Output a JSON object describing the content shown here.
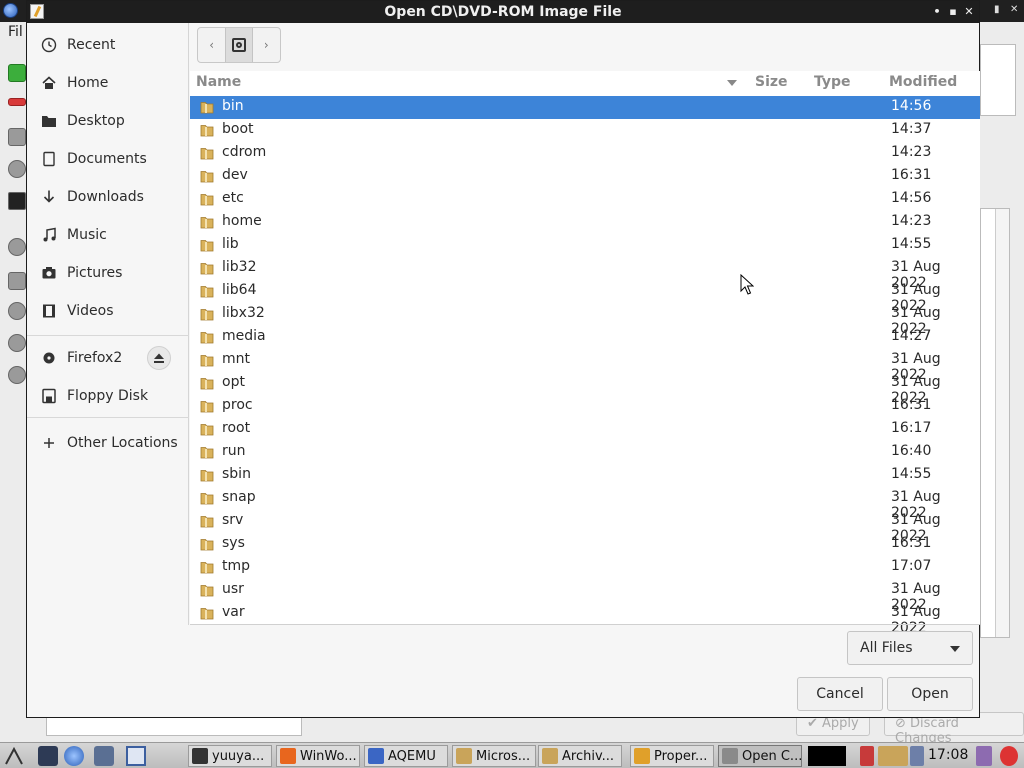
{
  "window": {
    "title": "Open CD\\DVD-ROM Image File",
    "controls": [
      "•",
      "▪",
      "✕"
    ]
  },
  "background_app": {
    "menu_label": "Fil",
    "buttons": {
      "apply": "Apply",
      "discard": "Discard Changes"
    }
  },
  "sidebar": {
    "places": [
      {
        "label": "Recent",
        "icon": "clock-icon"
      },
      {
        "label": "Home",
        "icon": "home-icon"
      },
      {
        "label": "Desktop",
        "icon": "folder-icon"
      },
      {
        "label": "Documents",
        "icon": "document-icon"
      },
      {
        "label": "Downloads",
        "icon": "download-arrow-icon"
      },
      {
        "label": "Music",
        "icon": "music-note-icon"
      },
      {
        "label": "Pictures",
        "icon": "camera-icon"
      },
      {
        "label": "Videos",
        "icon": "film-icon"
      }
    ],
    "devices": [
      {
        "label": "Firefox2",
        "icon": "optical-disc-icon",
        "eject": true
      },
      {
        "label": "Floppy Disk",
        "icon": "floppy-disk-icon"
      }
    ],
    "other": {
      "label": "Other Locations",
      "icon": "plus-icon"
    }
  },
  "pathbar": {
    "back": "‹",
    "forward": "›",
    "current_icon": "disk-drive-icon"
  },
  "filelist": {
    "columns": {
      "name": "Name",
      "size": "Size",
      "type": "Type",
      "modified": "Modified"
    },
    "sort_column": "Name",
    "rows": [
      {
        "name": "bin",
        "modified": "14:56",
        "selected": true
      },
      {
        "name": "boot",
        "modified": "14:37"
      },
      {
        "name": "cdrom",
        "modified": "14:23"
      },
      {
        "name": "dev",
        "modified": "16:31"
      },
      {
        "name": "etc",
        "modified": "14:56"
      },
      {
        "name": "home",
        "modified": "14:23"
      },
      {
        "name": "lib",
        "modified": "14:55"
      },
      {
        "name": "lib32",
        "modified": "31 Aug 2022"
      },
      {
        "name": "lib64",
        "modified": "31 Aug 2022"
      },
      {
        "name": "libx32",
        "modified": "31 Aug 2022"
      },
      {
        "name": "media",
        "modified": "14:27"
      },
      {
        "name": "mnt",
        "modified": "31 Aug 2022"
      },
      {
        "name": "opt",
        "modified": "31 Aug 2022"
      },
      {
        "name": "proc",
        "modified": "16:31"
      },
      {
        "name": "root",
        "modified": "16:17"
      },
      {
        "name": "run",
        "modified": "16:40"
      },
      {
        "name": "sbin",
        "modified": "14:55"
      },
      {
        "name": "snap",
        "modified": "31 Aug 2022"
      },
      {
        "name": "srv",
        "modified": "31 Aug 2022"
      },
      {
        "name": "sys",
        "modified": "16:31"
      },
      {
        "name": "tmp",
        "modified": "17:07"
      },
      {
        "name": "usr",
        "modified": "31 Aug 2022"
      },
      {
        "name": "var",
        "modified": "31 Aug 2022"
      }
    ]
  },
  "footer": {
    "filter_label": "All Files",
    "cancel_label": "Cancel",
    "open_label": "Open"
  },
  "taskbar": {
    "items": [
      {
        "label": "yuuya...",
        "icon": "terminal-icon",
        "color": "#333333"
      },
      {
        "label": "WinWo...",
        "icon": "firefox-icon",
        "color": "#e8661e"
      },
      {
        "label": "AQEMU",
        "icon": "aqemu-icon",
        "color": "#3b66c4"
      },
      {
        "label": "Micros...",
        "icon": "archive-icon",
        "color": "#c9a45a"
      },
      {
        "label": "Archiv...",
        "icon": "archive-icon",
        "color": "#c9a45a"
      },
      {
        "label": "Proper...",
        "icon": "edit-icon",
        "color": "#e0a02a"
      },
      {
        "label": "Open C...",
        "icon": "window-icon",
        "color": "#8a8a8a",
        "active": true
      }
    ],
    "clock": "17:08"
  },
  "colors": {
    "selection": "#3d84d8",
    "titlebar": "#1e1e1e",
    "folder": "#d9b25b"
  }
}
